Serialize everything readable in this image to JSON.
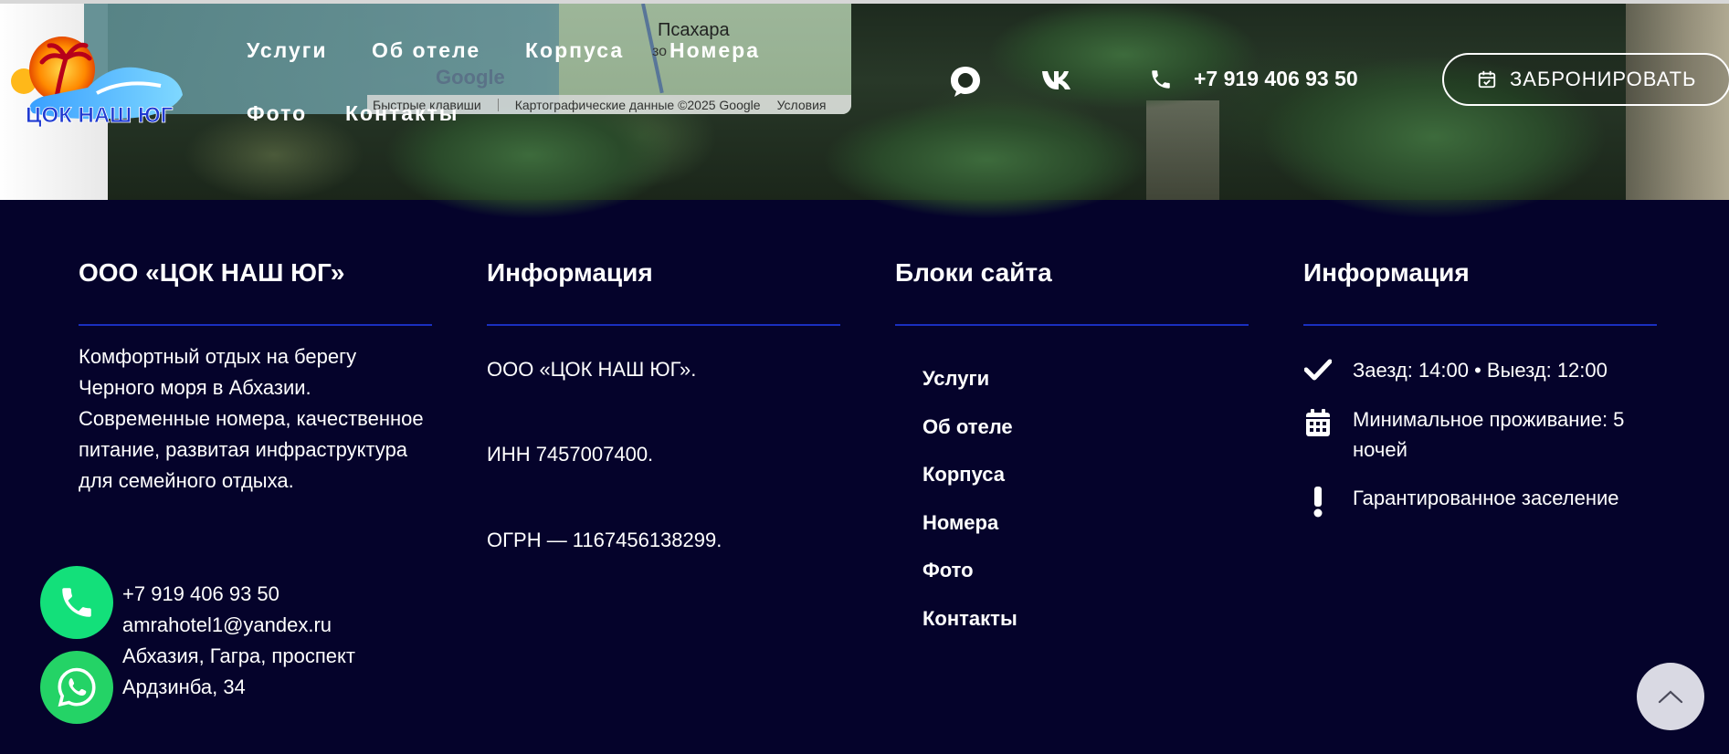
{
  "map": {
    "place_name": "Псахара",
    "place_sub": "зо",
    "google_logo": "Google",
    "footer": [
      "Быстрые клавиши",
      "Картографические данные ©2025 Google",
      "Условия"
    ]
  },
  "logo": {
    "text": "ЦОК НАШ ЮГ"
  },
  "nav": {
    "items": [
      "Услуги",
      "Об отеле",
      "Корпуса",
      "Номера",
      "Фото",
      "Контакты"
    ]
  },
  "header": {
    "chat_icon": "chat-bubble-icon",
    "vk_label": "VK",
    "phone": "+7 919 406 93 50",
    "book_label": "ЗАБРОНИРОВАТЬ"
  },
  "footer": {
    "col1": {
      "title": "ООО «ЦОК НАШ ЮГ»",
      "about": "Комфортный отдых на берегу Черного моря в Абхазии. Современные номера, качественное питание, развитая инфраструктура для семейного отдыха.",
      "phone": "+7 919 406 93 50",
      "email": "amrahotel1@yandex.ru",
      "address_1": "Абхазия, Гагра, проспект",
      "address_2": "Ардзинба, 34"
    },
    "col2": {
      "title": "Информация",
      "company": "ООО «ЦОК НАШ ЮГ».",
      "inn": "ИНН 7457007400.",
      "ogrn": "ОГРН — 1167456138299."
    },
    "col3": {
      "title": "Блоки сайта",
      "links": [
        "Услуги",
        "Об отеле",
        "Корпуса",
        "Номера",
        "Фото",
        "Контакты"
      ]
    },
    "col4": {
      "title": "Информация",
      "features": [
        {
          "icon": "checkmark-icon",
          "text": "Заезд: 14:00 • Выезд: 12:00"
        },
        {
          "icon": "calendar-icon",
          "text": "Минимальное проживание: 5 ночей"
        },
        {
          "icon": "exclamation-icon",
          "text": "Гарантированное заселение"
        }
      ]
    }
  },
  "colors": {
    "footer_bg": "#05032b",
    "rule": "#1a2fbf",
    "fab_phone": "#13e07a",
    "fab_whatsapp": "#24d366"
  }
}
